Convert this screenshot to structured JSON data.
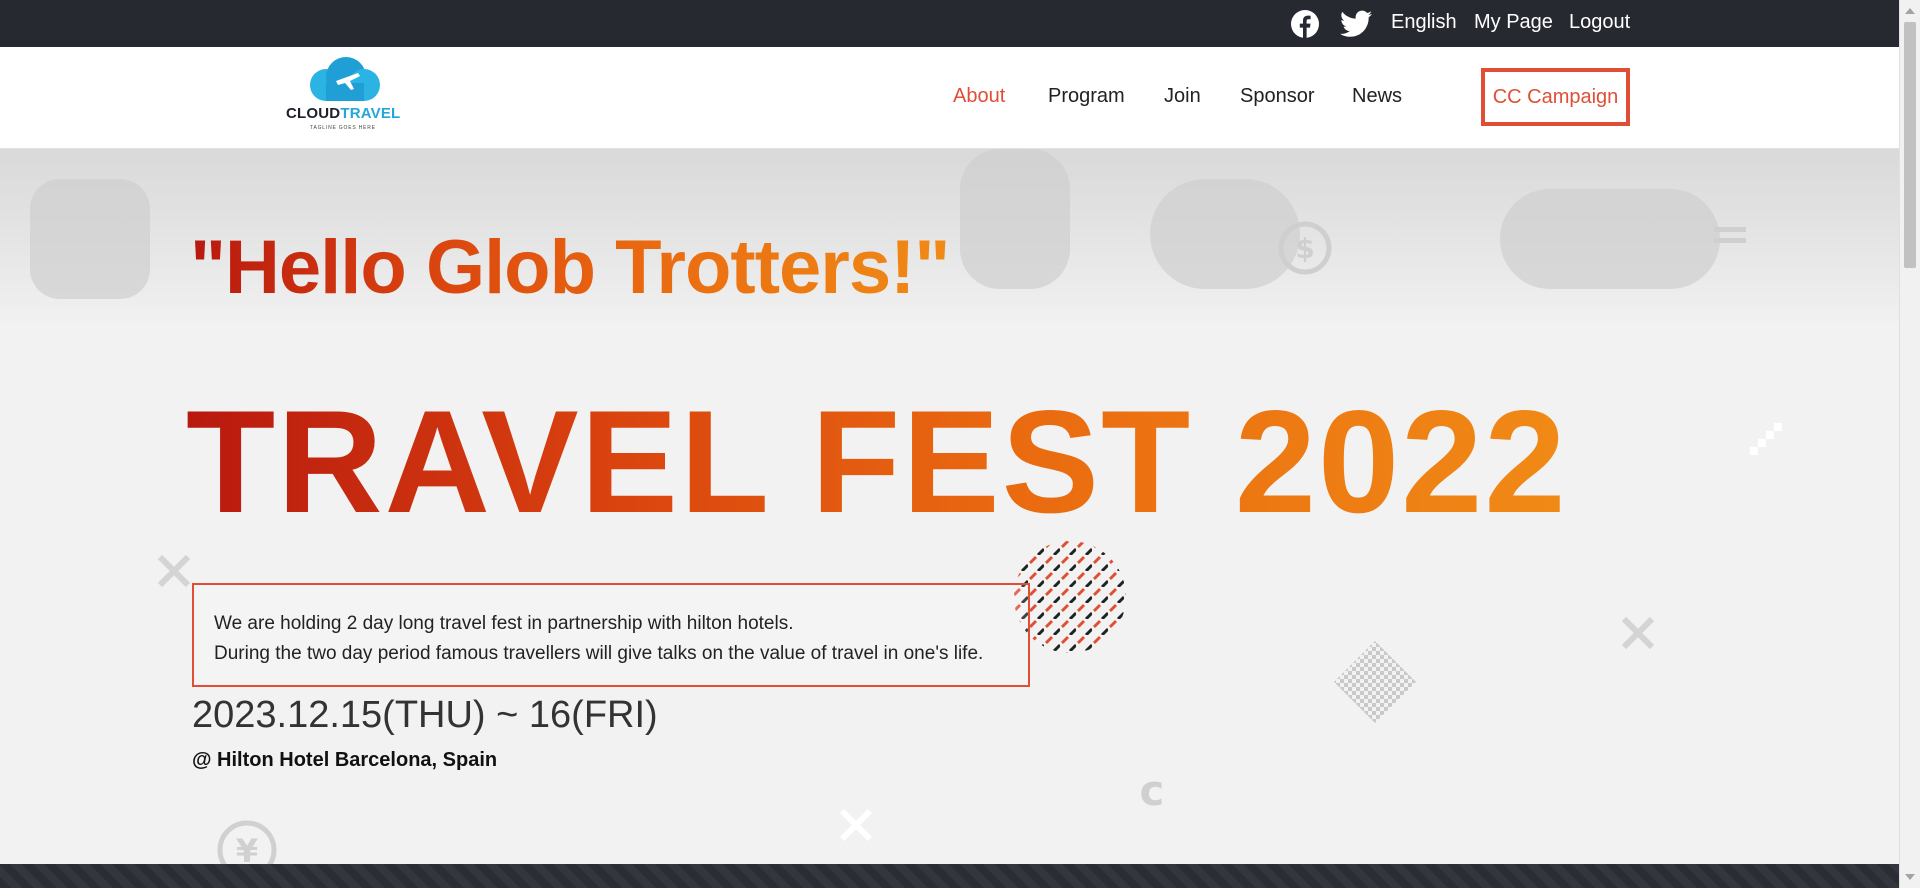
{
  "topbar": {
    "facebook_icon": "facebook-icon",
    "twitter_icon": "twitter-icon",
    "language": "English",
    "mypage": "My Page",
    "logout": "Logout"
  },
  "logo": {
    "brand_part1": "CLOUD",
    "brand_part2": "TRAVEL",
    "tagline": "TAGLINE GOES HERE"
  },
  "nav": {
    "items": [
      {
        "label": "About",
        "active": true
      },
      {
        "label": "Program",
        "active": false
      },
      {
        "label": "Join",
        "active": false
      },
      {
        "label": "Sponsor",
        "active": false
      },
      {
        "label": "News",
        "active": false
      }
    ],
    "cta": "CC Campaign"
  },
  "hero": {
    "tagline": "\"Hello Glob Trotters!\"",
    "title": "TRAVEL FEST 2022",
    "description": [
      "We are holding 2 day long travel fest in partnership with hilton hotels.",
      "During the two day period famous travellers will give talks on the value of travel in one's life."
    ],
    "date": "2023.12.15(THU) ~ 16(FRI)",
    "venue": "@ Hilton Hotel Barcelona, Spain"
  },
  "colors": {
    "accent": "#e04e36",
    "topbar_bg": "#262930",
    "title_gradient_start": "#b8180f",
    "title_gradient_end": "#f08a16"
  }
}
